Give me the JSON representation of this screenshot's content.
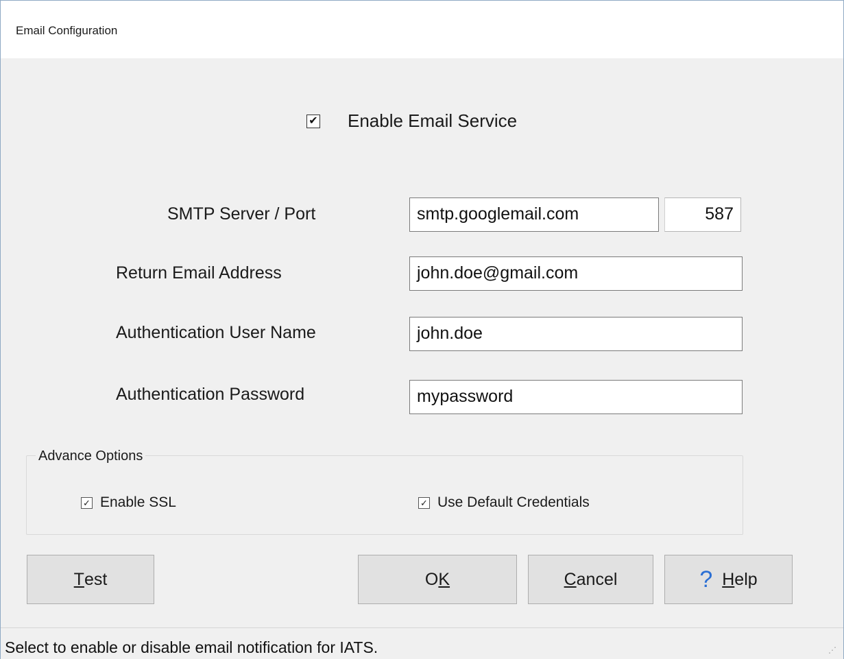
{
  "window": {
    "title": "Email Configuration"
  },
  "enable_email": {
    "label": "Enable Email Service",
    "checked": true
  },
  "fields": {
    "smtp_label": "SMTP Server / Port",
    "smtp_server": "smtp.googlemail.com",
    "smtp_port": "587",
    "return_label": "Return Email Address",
    "return_email": "john.doe@gmail.com",
    "user_label": "Authentication User Name",
    "user_name": "john.doe",
    "password_label": "Authentication Password",
    "password": "mypassword"
  },
  "advanced": {
    "legend": "Advance Options",
    "ssl_label": "Enable SSL",
    "ssl_checked": true,
    "credentials_label": "Use Default Credentials",
    "credentials_checked": true
  },
  "buttons": {
    "test_mnemonic": "T",
    "test_rest": "est",
    "ok_first": "O",
    "ok_mnemonic": "K",
    "cancel_mnemonic": "C",
    "cancel_rest": "ancel",
    "help_icon": "?",
    "help_mnemonic": "H",
    "help_rest": "elp"
  },
  "status": {
    "text": "Select to enable or disable email notification for IATS."
  },
  "icons": {
    "help": "question-mark-icon",
    "check": "checkmark-icon",
    "grip": "resize-grip-icon"
  }
}
